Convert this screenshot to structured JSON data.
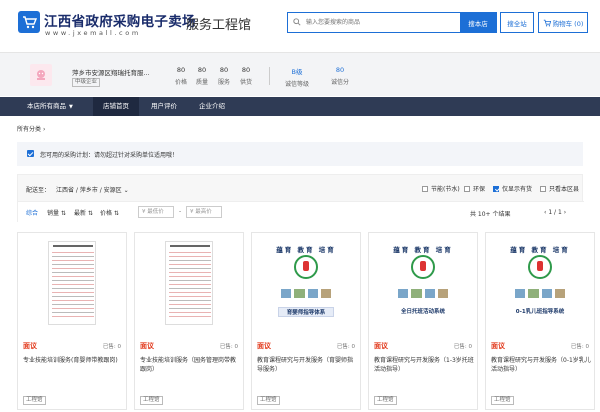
{
  "header": {
    "site_title": "江西省政府采购电子卖场",
    "site_url": "www.jxemall.com",
    "hall_title": "服务工程馆",
    "search_placeholder": "输入您要搜索的商品",
    "search_store_label": "搜本店",
    "search_all_label": "搜全站",
    "cart_label": "购物车 (0)",
    "brand_color": "#1d6fd6"
  },
  "store": {
    "name": "萍乡市安源区翔瑞托育服...",
    "tag": "中级企业",
    "stats": [
      {
        "value": "80",
        "label": "价格"
      },
      {
        "value": "80",
        "label": "质量"
      },
      {
        "value": "80",
        "label": "服务"
      },
      {
        "value": "80",
        "label": "供货"
      },
      {
        "value": "B级",
        "label": "诚信等级"
      },
      {
        "value": "80",
        "label": "诚信分"
      }
    ]
  },
  "nav": {
    "all_goods": "本店所有商品",
    "home": "店铺首页",
    "reviews": "用户评价",
    "about": "企业介绍"
  },
  "breadcrumb": "所有分类",
  "notice": "您可用的采购计划：请勿超过针对采购单位适用哦！",
  "filter": {
    "ship_label": "配送至：",
    "ship_region": "江西省 / 萍乡市 / 安源区",
    "checks": [
      {
        "label": "节能(节水)",
        "checked": false
      },
      {
        "label": "环保",
        "checked": false
      },
      {
        "label": "仅显示有货",
        "checked": true
      },
      {
        "label": "只看本区县",
        "checked": false
      }
    ],
    "sorts": [
      "综合",
      "销量",
      "最新",
      "价格"
    ],
    "price_min_placeholder": "¥ 最低价",
    "price_max_placeholder": "¥ 最高价",
    "price_dash": "-",
    "result_count": "共 10+ 个结果",
    "pager": "1 / 1"
  },
  "products": [
    {
      "price": "面议",
      "sold": "已售: 0",
      "name": "专业技能培训服务(育婴师带教跟岗)",
      "tag": "工程馆"
    },
    {
      "price": "面议",
      "sold": "已售: 0",
      "name": "专业技能培训服务（园务管理岗带教跟岗）",
      "tag": "工程馆"
    },
    {
      "price": "面议",
      "sold": "已售: 0",
      "name": "教育课程研究与开发服务（育婴师指导服务）",
      "tag": "工程馆",
      "poster_title": "蕴育 教育 培育",
      "poster_caption": "育婴师指导体系"
    },
    {
      "price": "面议",
      "sold": "已售: 0",
      "name": "教育课程研究与开发服务（1-3岁托班活动指导）",
      "tag": "工程馆",
      "poster_title": "蕴育 教育 培育",
      "poster_caption": "全日托班活动系统"
    },
    {
      "price": "面议",
      "sold": "已售: 0",
      "name": "教育课程研究与开发服务（0-1岁乳儿活动指导）",
      "tag": "工程馆",
      "poster_title": "蕴育 教育 培育",
      "poster_caption": "0-1乳儿班指导系统"
    }
  ]
}
